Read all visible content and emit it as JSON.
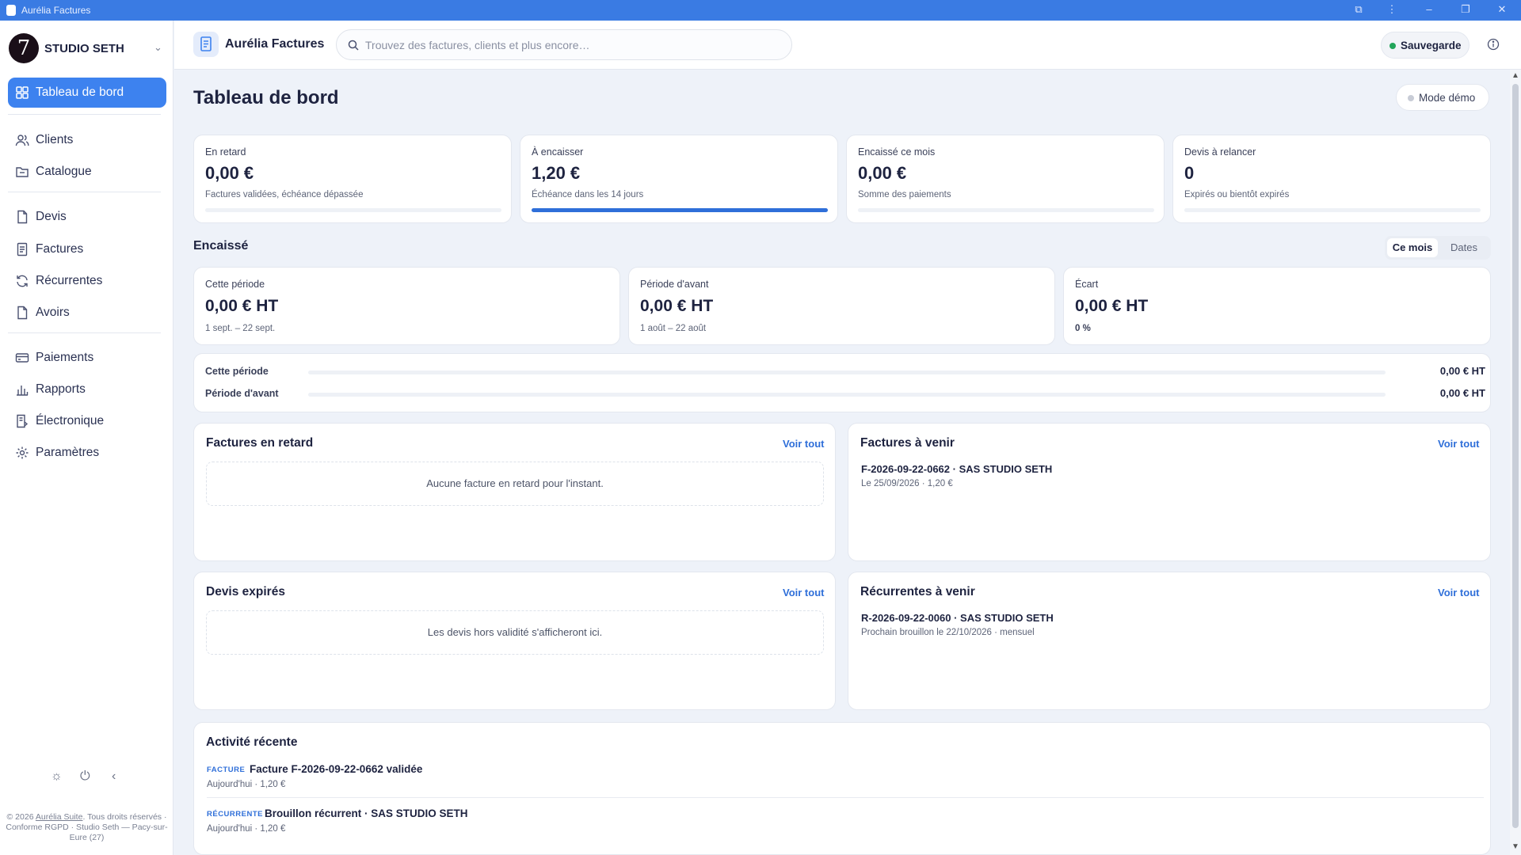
{
  "window": {
    "title": "Aurélia Factures",
    "controls": [
      "extension-icon",
      "kebab-icon",
      "minimize-icon",
      "restore-icon",
      "close-icon"
    ]
  },
  "sidebar": {
    "brand_logo": "7",
    "brand_name": "STUDIO SETH",
    "items": [
      {
        "label": "Tableau de bord",
        "icon": "dashboard-grid-icon",
        "active": true
      },
      {
        "label": "Clients",
        "icon": "users-icon"
      },
      {
        "label": "Catalogue",
        "icon": "folder-icon"
      },
      {
        "label": "Devis",
        "icon": "document-icon"
      },
      {
        "label": "Factures",
        "icon": "invoice-icon"
      },
      {
        "label": "Récurrentes",
        "icon": "refresh-icon"
      },
      {
        "label": "Avoirs",
        "icon": "credit-note-icon"
      },
      {
        "label": "Paiements",
        "icon": "card-icon"
      },
      {
        "label": "Rapports",
        "icon": "bar-chart-icon"
      },
      {
        "label": "Électronique",
        "icon": "e-invoice-icon"
      },
      {
        "label": "Paramètres",
        "icon": "gear-icon"
      }
    ],
    "footer": {
      "prefix": "© 2026 ",
      "link": "Aurélia Suite",
      "rest": ". Tous droits réservés · Conforme RGPD · Studio Seth — Pacy-sur-Eure (27)"
    }
  },
  "topbar": {
    "app_title": "Aurélia Factures",
    "search_placeholder": "Trouvez des factures, clients et plus encore…",
    "save_label": "Sauvegarde"
  },
  "page": {
    "title": "Tableau de bord",
    "demo_label": "Mode démo"
  },
  "kpis": [
    {
      "label": "En retard",
      "value": "0,00 €",
      "sub": "Factures validées, échéance dépassée",
      "progress": 0
    },
    {
      "label": "À encaisser",
      "value": "1,20 €",
      "sub": "Échéance dans les 14 jours",
      "progress": 1
    },
    {
      "label": "Encaissé ce mois",
      "value": "0,00 €",
      "sub": "Somme des paiements",
      "progress": 0
    },
    {
      "label": "Devis à relancer",
      "value": "0",
      "sub": "Expirés ou bientôt expirés",
      "progress": 0
    }
  ],
  "encaisse": {
    "title": "Encaissé",
    "tabs": [
      "Ce mois",
      "Dates"
    ],
    "periods": [
      {
        "label": "Cette période",
        "value": "0,00 € HT",
        "sub": "1 sept. – 22 sept."
      },
      {
        "label": "Période d'avant",
        "value": "0,00 € HT",
        "sub": "1 août – 22 août"
      },
      {
        "label": "Écart",
        "value": "0,00 € HT",
        "sub": "0 %"
      }
    ],
    "comparison": [
      {
        "label": "Cette période",
        "value": "0,00 € HT",
        "fraction": 0
      },
      {
        "label": "Période d'avant",
        "value": "0,00 € HT",
        "fraction": 0
      }
    ]
  },
  "panels": {
    "voir_tout": "Voir tout",
    "retard": {
      "title": "Factures en retard",
      "empty": "Aucune facture en retard pour l'instant."
    },
    "a_venir": {
      "title": "Factures à venir",
      "items": [
        {
          "title": "F-2026-09-22-0662 · SAS STUDIO SETH",
          "sub": "Le 25/09/2026 · 1,20 €"
        }
      ]
    },
    "devis": {
      "title": "Devis expirés",
      "empty": "Les devis hors validité s'afficheront ici."
    },
    "recurrentes": {
      "title": "Récurrentes à venir",
      "items": [
        {
          "title": "R-2026-09-22-0060 · SAS STUDIO SETH",
          "sub": "Prochain brouillon le 22/10/2026 · mensuel"
        }
      ]
    }
  },
  "activity": {
    "title": "Activité récente",
    "items": [
      {
        "tag": "FACTURE",
        "title": "Facture F-2026-09-22-0662 validée",
        "sub": "Aujourd'hui · 1,20 €"
      },
      {
        "tag": "RÉCURRENTE",
        "title": "Brouillon récurrent · SAS STUDIO SETH",
        "sub": "Aujourd'hui · 1,20 €"
      }
    ]
  },
  "colors": {
    "accent": "#3d82ef",
    "titlebar": "#3a7be3",
    "link": "#2f6fd9",
    "status_ok": "#22a55a",
    "background": "#eef2f9"
  }
}
